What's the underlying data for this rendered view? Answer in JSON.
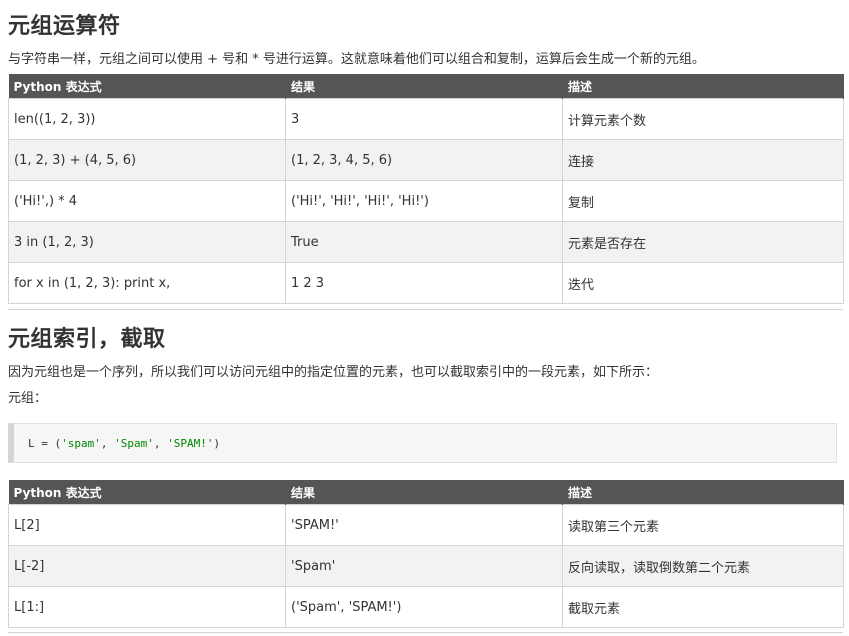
{
  "section1": {
    "heading": "元组运算符",
    "intro": "与字符串一样，元组之间可以使用 + 号和 * 号进行运算。这就意味着他们可以组合和复制，运算后会生成一个新的元组。",
    "headers": [
      "Python 表达式",
      "结果",
      "描述"
    ],
    "rows": [
      [
        "len((1, 2, 3))",
        "3",
        "计算元素个数"
      ],
      [
        "(1, 2, 3) + (4, 5, 6)",
        "(1, 2, 3, 4, 5, 6)",
        "连接"
      ],
      [
        "('Hi!',) * 4",
        "('Hi!', 'Hi!', 'Hi!', 'Hi!')",
        "复制"
      ],
      [
        "3 in (1, 2, 3)",
        "True",
        "元素是否存在"
      ],
      [
        "for x in (1, 2, 3): print x,",
        "1 2 3",
        "迭代"
      ]
    ]
  },
  "section2": {
    "heading": "元组索引，截取",
    "intro": "因为元组也是一个序列，所以我们可以访问元组中的指定位置的元素，也可以截取索引中的一段元素，如下所示：",
    "label": "元组：",
    "code": {
      "prefix": "L = (",
      "s1": "'spam'",
      "s2": "'Spam'",
      "s3": "'SPAM!'",
      "sep": ", ",
      "suffix": ")"
    },
    "headers": [
      "Python 表达式",
      "结果",
      "描述"
    ],
    "rows": [
      [
        "L[2]",
        "'SPAM!'",
        "读取第三个元素"
      ],
      [
        "L[-2]",
        "'Spam'",
        "反向读取，读取倒数第二个元素"
      ],
      [
        "L[1:]",
        "('Spam', 'SPAM!')",
        "截取元素"
      ]
    ]
  }
}
